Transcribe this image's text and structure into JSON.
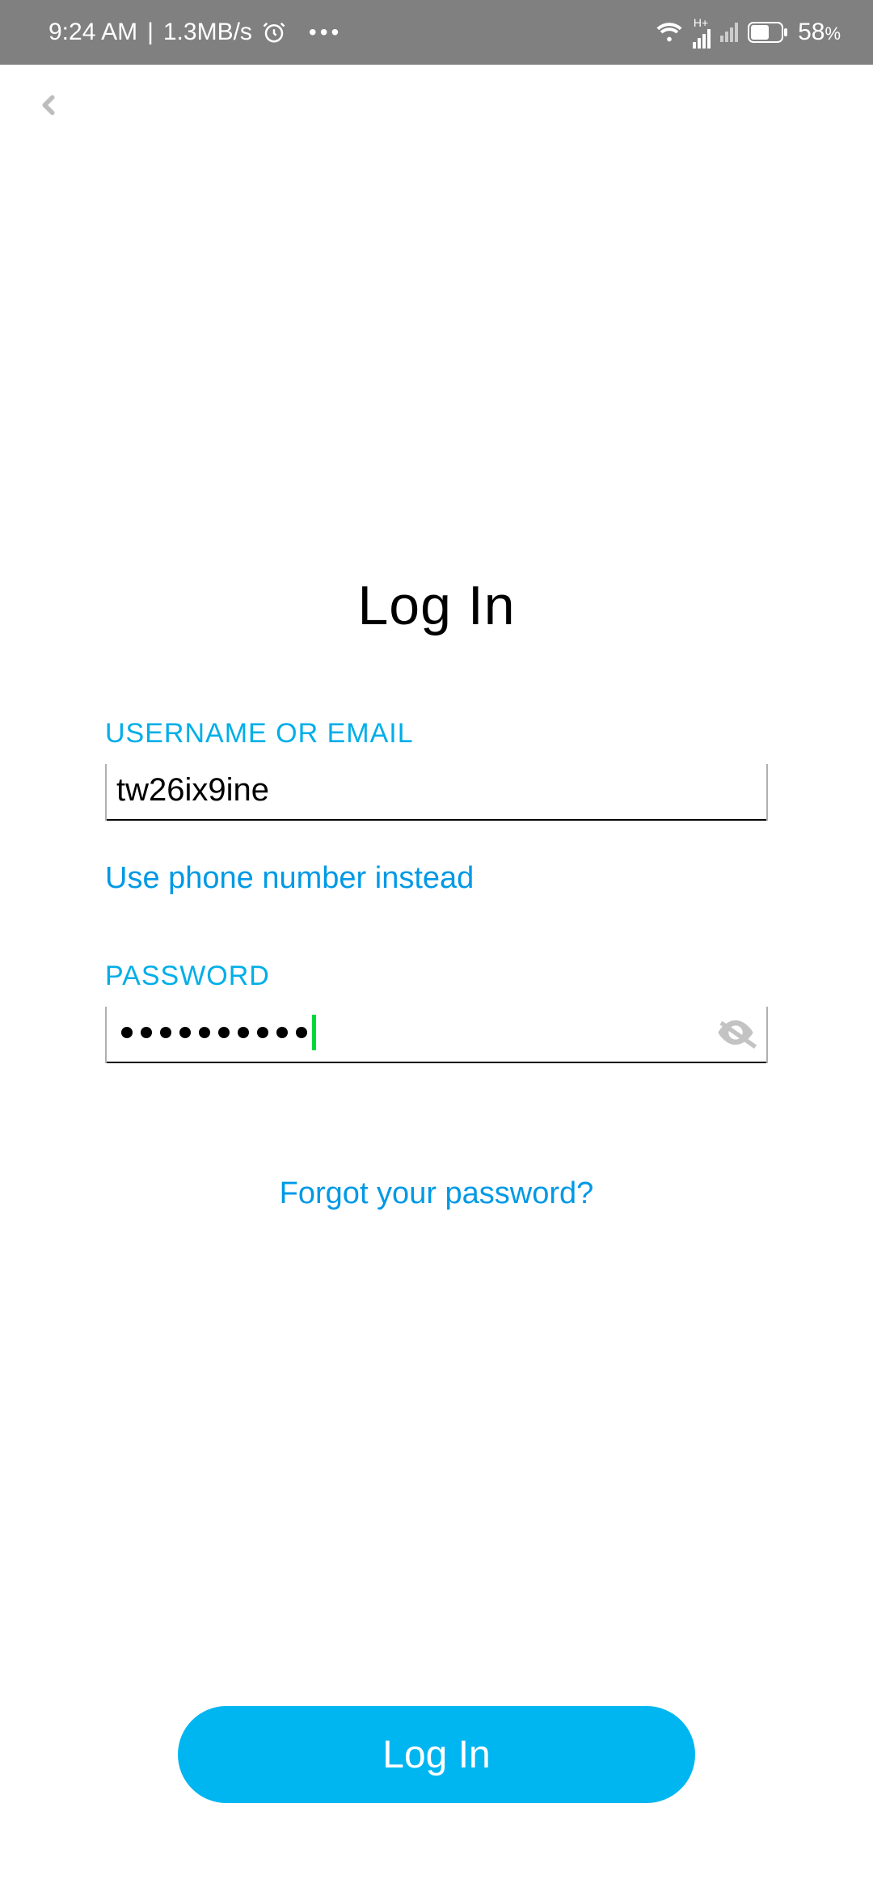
{
  "status_bar": {
    "time": "9:24 AM",
    "speed": "1.3MB/s",
    "network_label": "H+",
    "battery_percent": "58",
    "battery_suffix": "%"
  },
  "header": {},
  "login": {
    "title": "Log In",
    "username_label": "USERNAME OR EMAIL",
    "username_value": "tw26ix9ine",
    "use_phone_link": "Use phone number instead",
    "password_label": "PASSWORD",
    "password_dot_count": 10,
    "forgot_link": "Forgot your password?",
    "submit_label": "Log In"
  },
  "colors": {
    "accent": "#00b6f1",
    "link": "#0099e5",
    "cursor": "#00d93b"
  }
}
